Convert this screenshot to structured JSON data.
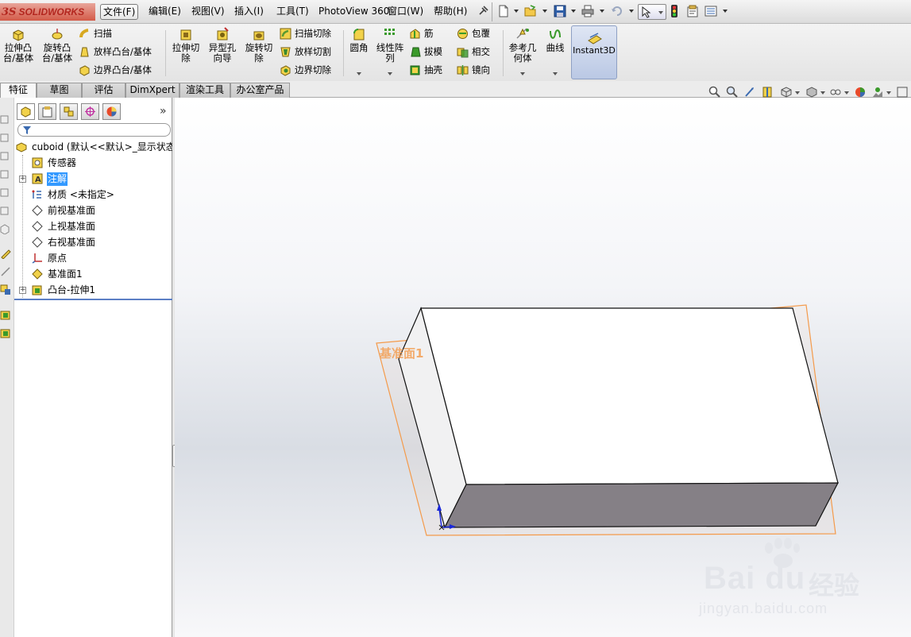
{
  "app": {
    "logo_prefix": "3S",
    "logo_name": "SOLIDWORKS"
  },
  "menubar": {
    "items": [
      "文件(F)",
      "编辑(E)",
      "视图(V)",
      "插入(I)",
      "工具(T)",
      "PhotoView 360",
      "窗口(W)",
      "帮助(H)"
    ]
  },
  "commands": {
    "extrude_boss": "拉伸凸台/基体",
    "revolve_boss": "旋转凸台/基体",
    "sweep": "扫描",
    "loft_boss": "放样凸台/基体",
    "boundary_boss": "边界凸台/基体",
    "extrude_cut": "拉伸切除",
    "hole_wizard": "异型孔向导",
    "revolve_cut": "旋转切除",
    "swept_cut": "扫描切除",
    "lofted_cut": "放样切割",
    "boundary_cut": "边界切除",
    "fillet": "圆角",
    "linear_pattern": "线性阵列",
    "rib": "筋",
    "draft": "拔模",
    "shell": "抽壳",
    "wrap": "包覆",
    "intersect": "相交",
    "mirror": "镜向",
    "ref_geometry": "参考几何体",
    "curves": "曲线",
    "instant3d": "Instant3D"
  },
  "tabs": [
    "特征",
    "草图",
    "评估",
    "DimXpert",
    "渲染工具",
    "办公室产品"
  ],
  "tree": {
    "root": "cuboid  (默认<<默认>_显示状态",
    "items": [
      "传感器",
      "注解",
      "材质 <未指定>",
      "前视基准面",
      "上视基准面",
      "右视基准面",
      "原点",
      "基准面1",
      "凸台-拉伸1"
    ]
  },
  "viewport": {
    "plane_label": "基准面1"
  },
  "watermark": {
    "brand": "Bai du",
    "brand_cn": "经验",
    "url": "jingyan.baidu.com"
  },
  "colors": {
    "selection": "#3399ff",
    "plane": "#f49a4a",
    "accent": "#b3261e"
  }
}
